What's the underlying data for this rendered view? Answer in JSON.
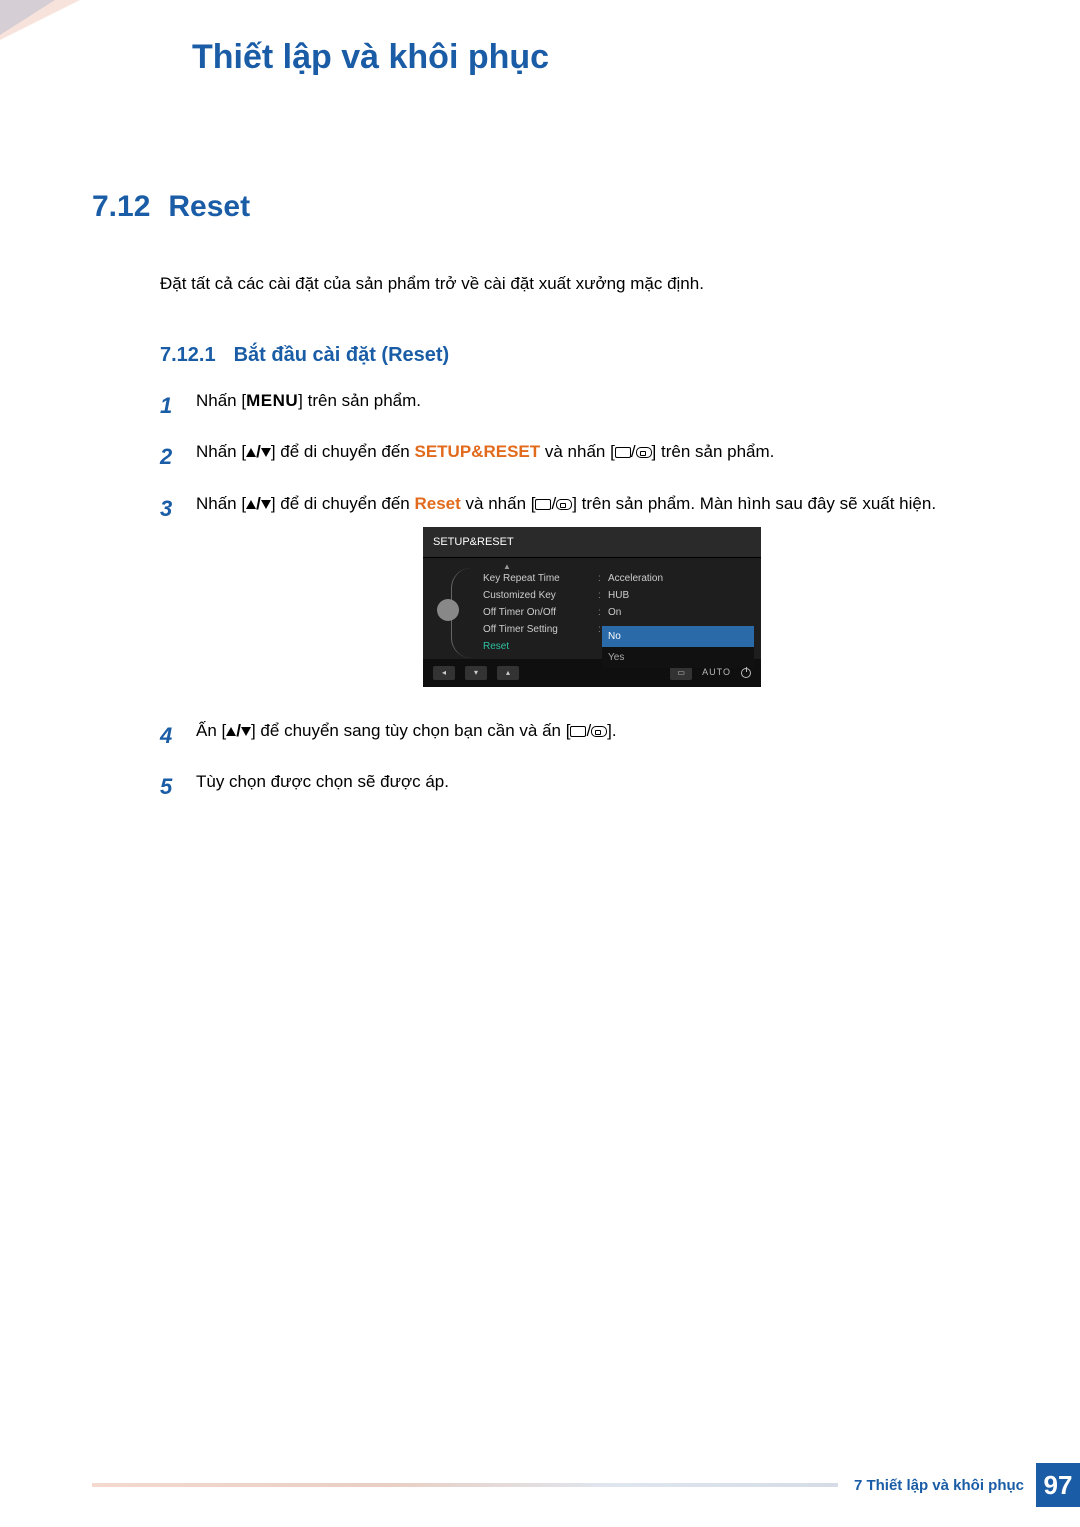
{
  "header": {
    "title": "Thiết lập và khôi phục"
  },
  "section": {
    "number": "7.12",
    "title": "Reset"
  },
  "intro": "Đặt tất cả các cài đặt của sản phẩm trở về cài đặt xuất xưởng mặc định.",
  "subsection": {
    "number": "7.12.1",
    "title": "Bắt đầu cài đặt (Reset)"
  },
  "steps": {
    "s1": {
      "num": "1",
      "a": "Nhấn [",
      "menu": "MENU",
      "b": "] trên sản phẩm."
    },
    "s2": {
      "num": "2",
      "a": "Nhấn [",
      "b": "] để di chuyển đến ",
      "target": "SETUP&RESET",
      "c": " và nhấn [",
      "d": "] trên sản phẩm."
    },
    "s3": {
      "num": "3",
      "a": "Nhấn [",
      "b": "] để di chuyển đến ",
      "target": "Reset",
      "c": " và nhấn [",
      "d": "] trên sản phẩm. Màn hình sau đây sẽ xuất hiện."
    },
    "s4": {
      "num": "4",
      "a": "Ấn [",
      "b": "] để chuyển sang tùy chọn bạn cần và ấn [",
      "c": "]."
    },
    "s5": {
      "num": "5",
      "text": "Tùy chọn được chọn sẽ được áp."
    }
  },
  "osd": {
    "title": "SETUP&RESET",
    "rows": [
      {
        "label": "Key Repeat Time",
        "value": "Acceleration"
      },
      {
        "label": "Customized Key",
        "value": "HUB"
      },
      {
        "label": "Off Timer On/Off",
        "value": "On"
      },
      {
        "label": "Off Timer Setting",
        "value": ""
      }
    ],
    "reset_label": "Reset",
    "popup": {
      "no": "No",
      "yes": "Yes"
    },
    "auto": "AUTO"
  },
  "footer": {
    "chapter": "7 Thiết lập và khôi phục",
    "page": "97"
  }
}
